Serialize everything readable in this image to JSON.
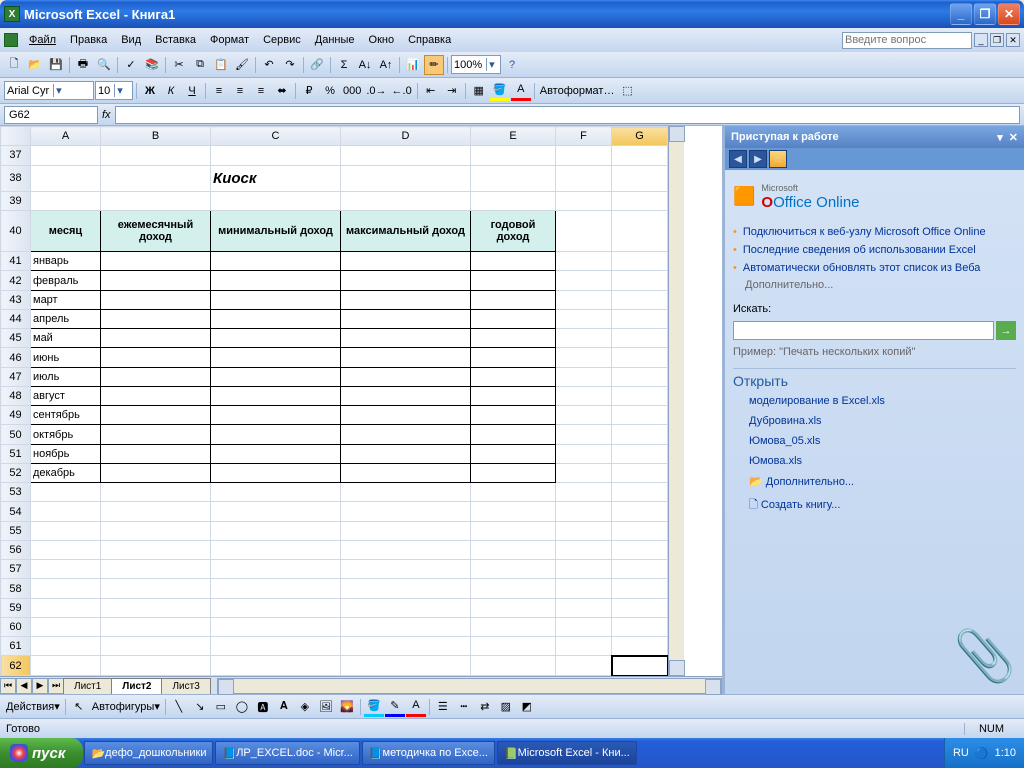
{
  "title": "Microsoft Excel - Книга1",
  "menus": [
    "Файл",
    "Правка",
    "Вид",
    "Вставка",
    "Формат",
    "Сервис",
    "Данные",
    "Окно",
    "Справка"
  ],
  "question_placeholder": "Введите вопрос",
  "font_name": "Arial Cyr",
  "font_size": "10",
  "zoom": "100%",
  "autoformat": "Автоформат…",
  "namebox": "G62",
  "columns": [
    "A",
    "B",
    "C",
    "D",
    "E",
    "F",
    "G"
  ],
  "row_start": 37,
  "row_end": 62,
  "title_cell": {
    "row": 38,
    "col": "C",
    "text": "Киоск"
  },
  "headers": {
    "row": 40,
    "A": "месяц",
    "B": "ежемесячный доход",
    "C": "минимальный доход",
    "D": "максимальный доход",
    "E": "годовой доход"
  },
  "months": [
    "январь",
    "февраль",
    "март",
    "апрель",
    "май",
    "июнь",
    "июль",
    "август",
    "сентябрь",
    "октябрь",
    "ноябрь",
    "декабрь"
  ],
  "sheet_tabs": [
    "Лист1",
    "Лист2",
    "Лист3"
  ],
  "active_tab": 1,
  "draw_label": "Действия",
  "autoshapes": "Автофигуры",
  "status": "Готово",
  "status_num": "NUM",
  "taskpane": {
    "title": "Приступая к работе",
    "office": "Office Online",
    "ms": "Microsoft",
    "links": [
      "Подключиться к веб-узлу Microsoft Office Online",
      "Последние сведения об использовании Excel",
      "Автоматически обновлять этот список из Веба"
    ],
    "more": "Дополнительно...",
    "search_label": "Искать:",
    "search_hint": "Пример: \"Печать нескольких копий\"",
    "open": "Открыть",
    "files": [
      "моделирование в Excel.xls",
      "Дубровина.xls",
      "Юмова_05.xls",
      "Юмова.xls"
    ],
    "more2": "Дополнительно...",
    "create": "Создать книгу..."
  },
  "taskbar": {
    "start": "пуск",
    "tasks": [
      "дефо_дошкольники",
      "ЛР_EXCEL.doc - Micr...",
      "методичка по Exce...",
      "Microsoft Excel - Кни..."
    ],
    "lang": "RU",
    "time": "1:10"
  }
}
